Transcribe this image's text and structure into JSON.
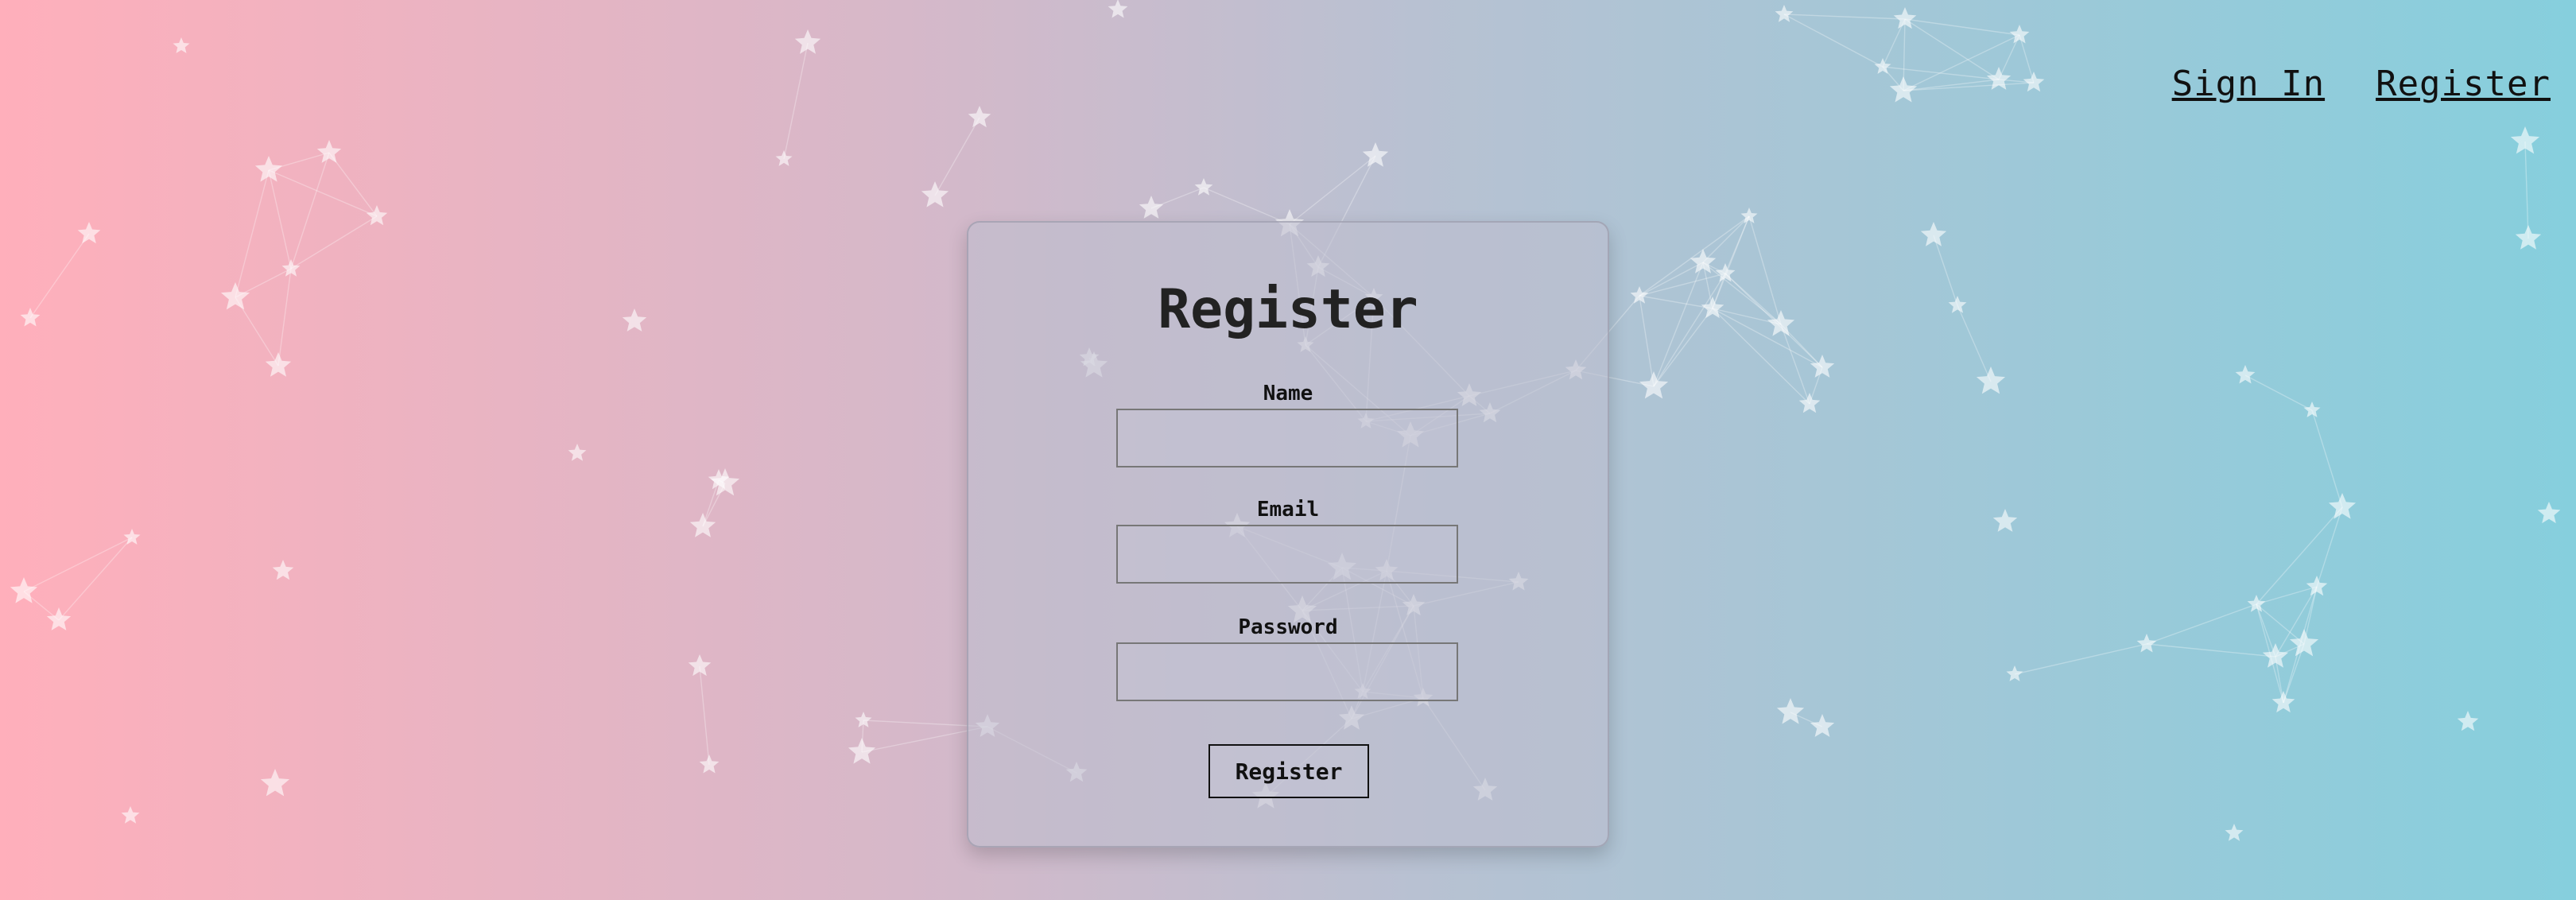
{
  "nav": {
    "sign_in": "Sign In",
    "register": "Register"
  },
  "form": {
    "title": "Register",
    "fields": [
      {
        "label": "Name",
        "value": "",
        "placeholder": ""
      },
      {
        "label": "Email",
        "value": "",
        "placeholder": ""
      },
      {
        "label": "Password",
        "value": "",
        "placeholder": ""
      }
    ],
    "submit_label": "Register"
  },
  "theme": {
    "gradient_left": "#ffafbb",
    "gradient_right": "#86cfdd",
    "star_color": "#ffffff",
    "text_color": "#222222"
  },
  "background": {
    "decoration": "star-network"
  }
}
